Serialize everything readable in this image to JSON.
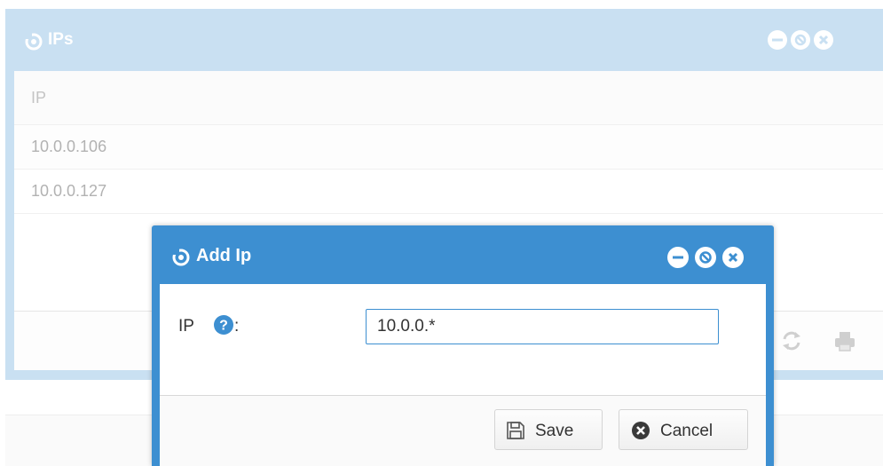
{
  "background_window": {
    "title": "IPs",
    "grid": {
      "column_header": "IP",
      "rows": [
        "10.0.0.106",
        "10.0.0.127"
      ]
    },
    "toolbar": {
      "refresh_icon": "refresh-icon",
      "print_icon": "print-icon"
    }
  },
  "dialog": {
    "title": "Add Ip",
    "fields": {
      "ip_label": "IP",
      "colon": ":",
      "ip_value": "10.0.0.*"
    },
    "buttons": {
      "save": "Save",
      "cancel": "Cancel"
    }
  },
  "colors": {
    "accent": "#3d8fd1",
    "faded_header": "#c9e0f2"
  }
}
